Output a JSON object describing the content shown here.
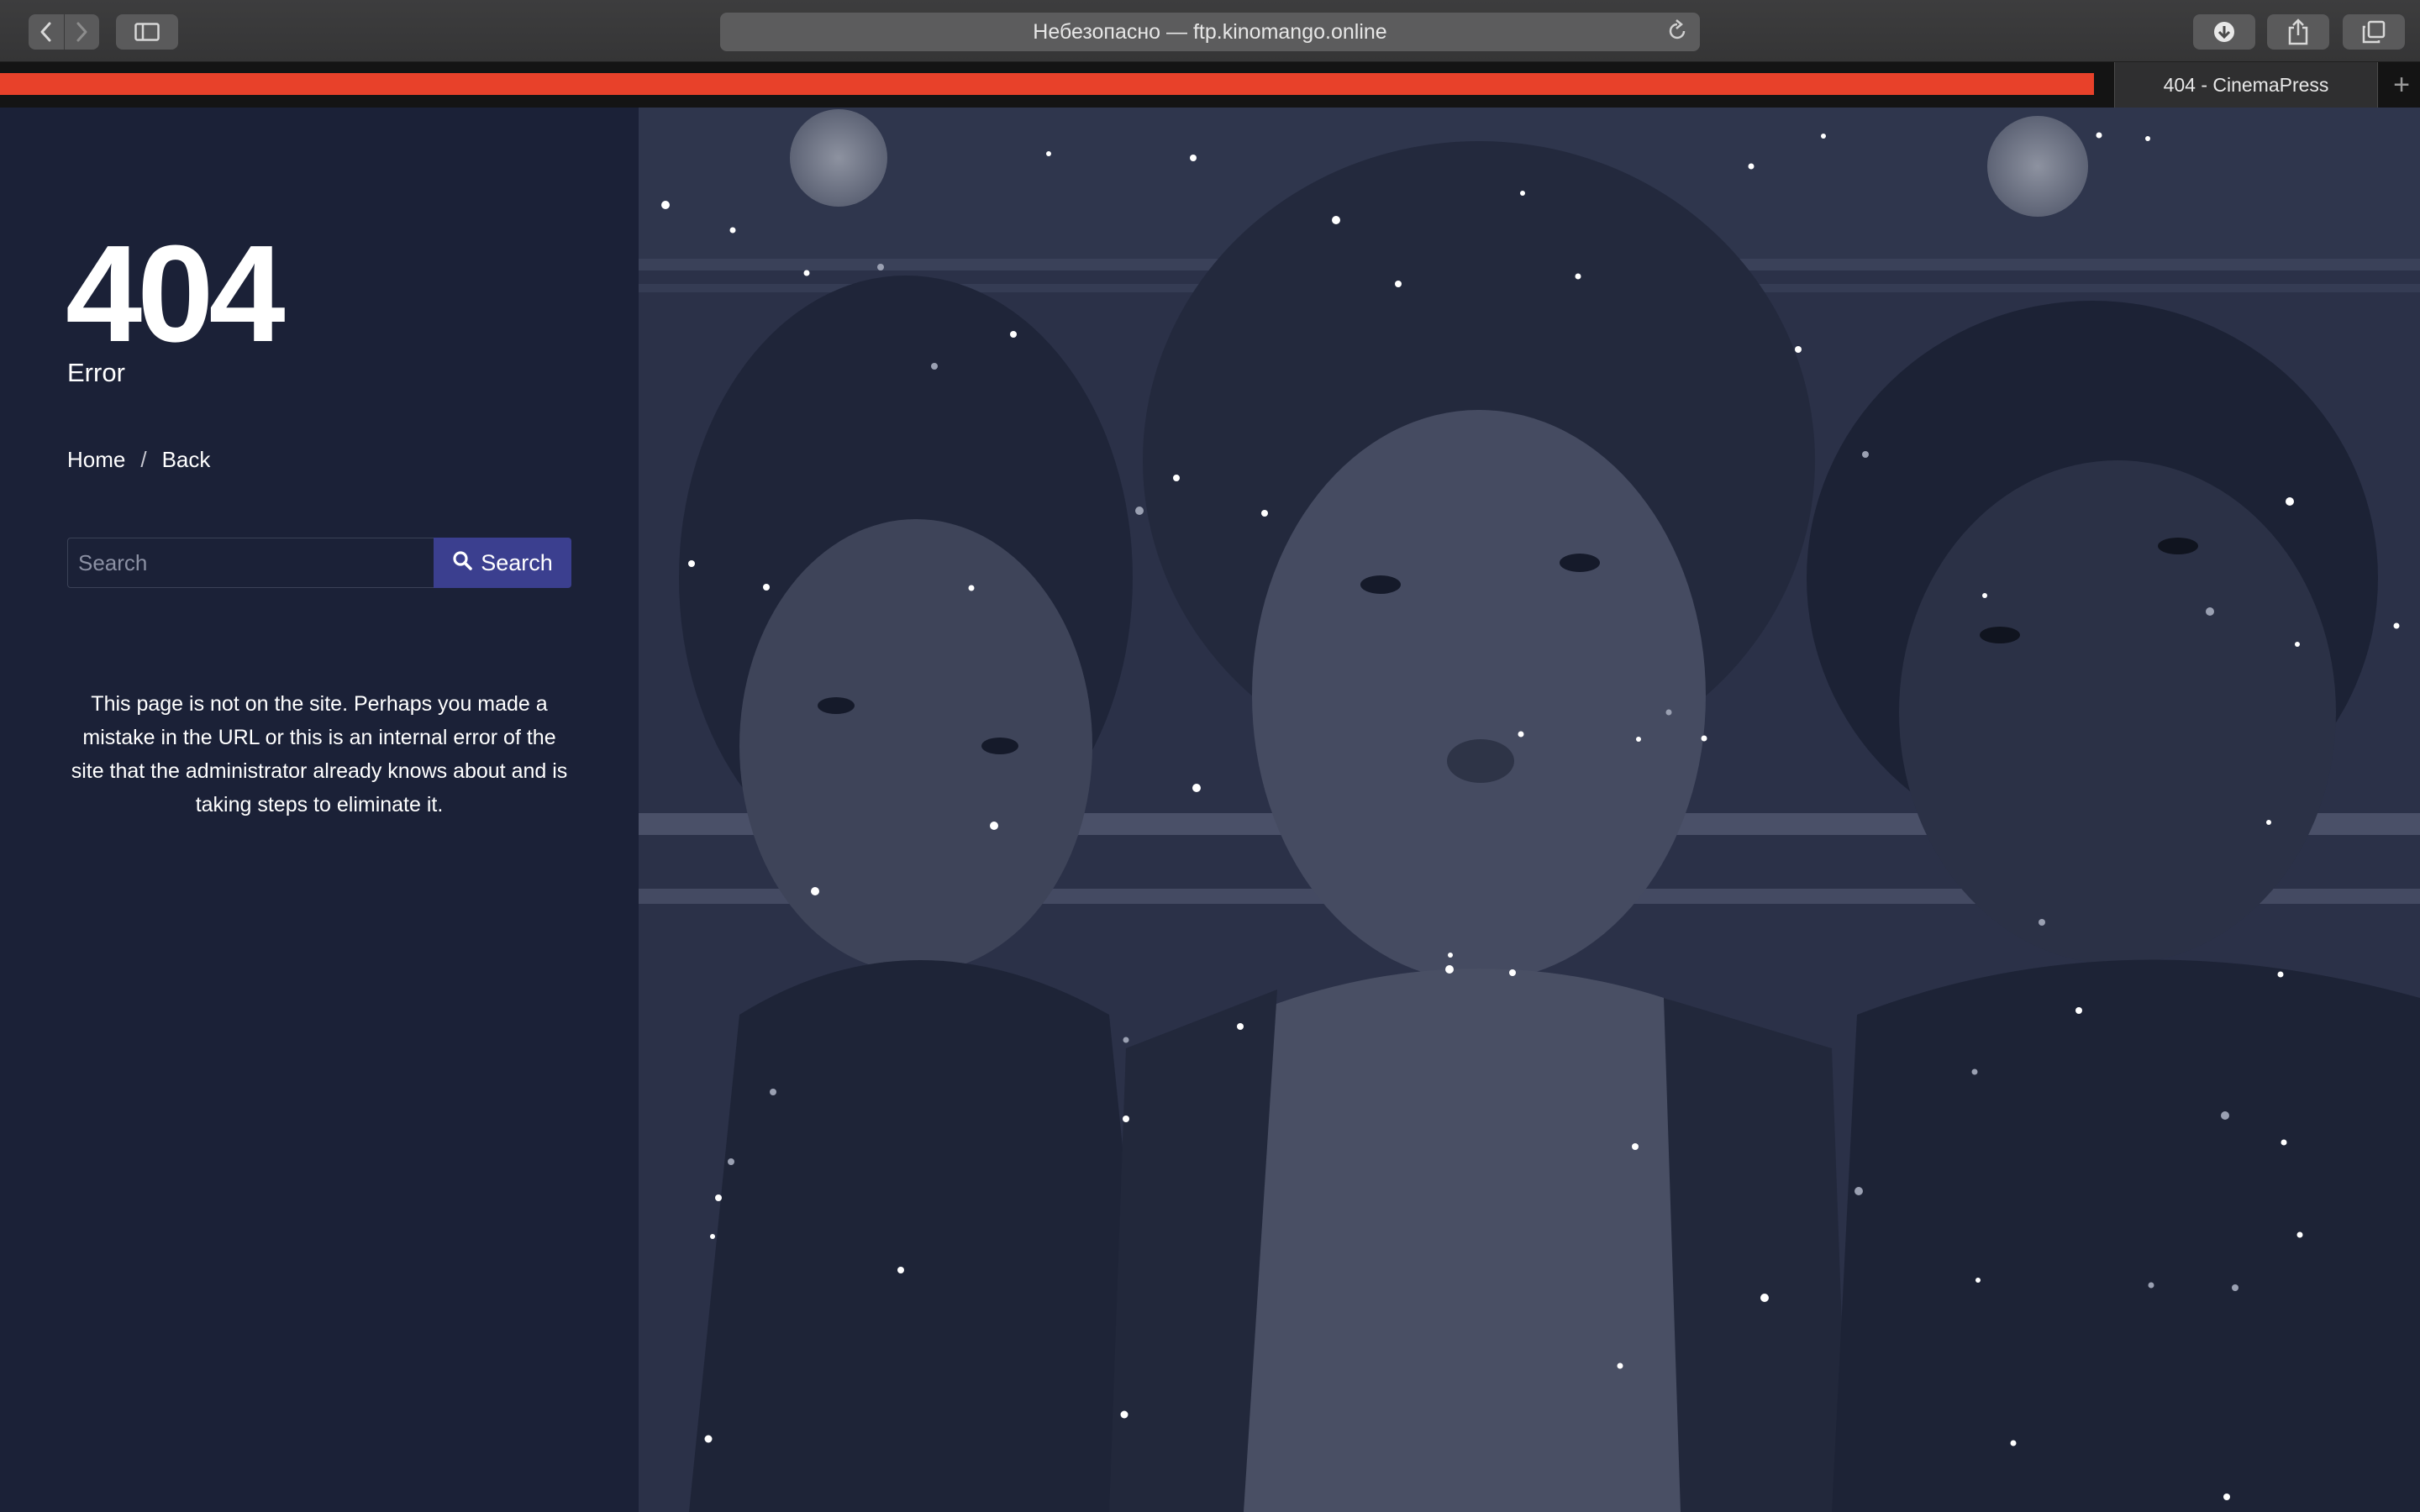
{
  "browser": {
    "address_text": "Небезопасно — ftp.kinomango.online",
    "tab_title": "404 - CinemaPress",
    "icons": [
      "back-icon",
      "forward-icon",
      "sidebar-icon",
      "reload-icon",
      "download-icon",
      "share-icon",
      "tabs-icon",
      "new-tab-icon"
    ]
  },
  "page": {
    "error_code": "404",
    "error_label": "Error",
    "breadcrumb": {
      "home": "Home",
      "separator": "/",
      "back": "Back"
    },
    "search": {
      "placeholder": "Search",
      "button_label": "Search"
    },
    "message": "This page is not on the site. Perhaps you made a mistake in the URL or this is an internal error of the site that the administrator already knows about and is taking steps to eliminate it."
  },
  "colors": {
    "progress_bar": "#e8412a",
    "panel_background": "#1b2137",
    "search_button": "#3b3f8f"
  }
}
